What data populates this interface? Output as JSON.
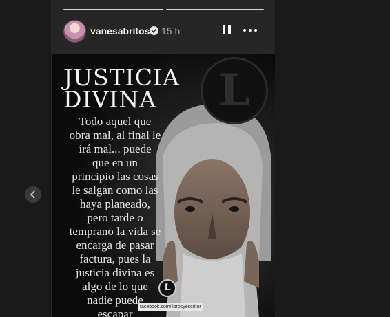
{
  "story": {
    "progress_segments": 2,
    "header": {
      "username": "vanesabritos",
      "verified_icon": "verified-badge-icon",
      "timestamp": "15 h",
      "pause_icon": "pause-icon",
      "more_icon": "more-options-icon"
    },
    "post": {
      "title": "JUSTICIA\nDIVINA",
      "body": "Todo aquel que\nobra mal, al final le\nirá mal... puede\nque en un\nprincipio las cosas\nle salgan como las\nhaya planeado,\npero tarde o\ntemprano la vida se\nencarga de pasar\nfactura, pues la\njusticia divina es\nalgo de lo que\nnadie puede\nescapar",
      "logo_letter": "L",
      "source_tag": "facebook.com/librosyescritor"
    }
  },
  "navigation": {
    "prev_icon": "chevron-left-icon"
  },
  "colors": {
    "background": "#1a1a1a",
    "story_background": "#262626",
    "text": "#f5f5f5"
  }
}
